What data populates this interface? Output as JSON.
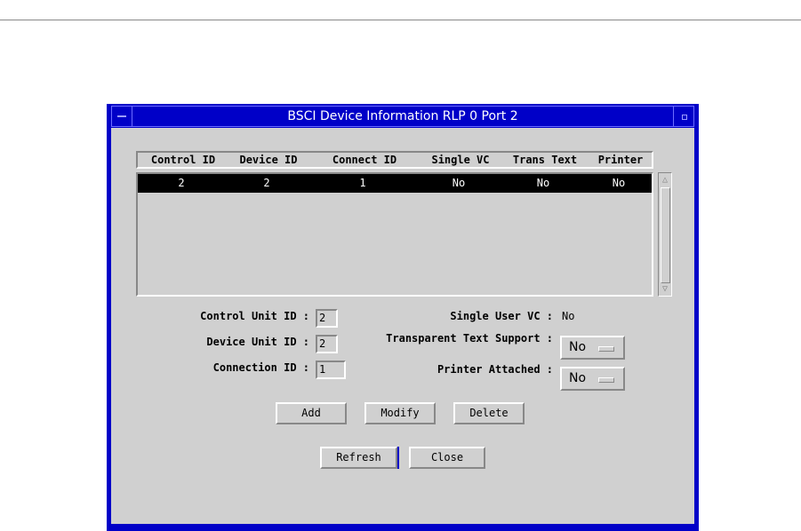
{
  "window": {
    "title": "BSCI Device Information RLP 0 Port 2"
  },
  "table": {
    "columns": [
      "Control ID",
      "Device ID",
      "Connect ID",
      "Single VC",
      "Trans Text",
      "Printer"
    ],
    "rows": [
      [
        "2",
        "2",
        "1",
        "No",
        "No",
        "No"
      ]
    ]
  },
  "form": {
    "control_unit_id": {
      "label": "Control Unit ID :",
      "value": "2"
    },
    "device_unit_id": {
      "label": "Device Unit ID :",
      "value": "2"
    },
    "connection_id": {
      "label": "Connection ID :",
      "value": "1"
    },
    "single_user_vc": {
      "label": "Single User VC :",
      "value": "No"
    },
    "transparent_text": {
      "label": "Transparent Text Support :",
      "value": "No"
    },
    "printer_attached": {
      "label": "Printer Attached :",
      "value": "No"
    }
  },
  "buttons": {
    "add": "Add",
    "modify": "Modify",
    "delete": "Delete",
    "refresh": "Refresh",
    "close": "Close"
  }
}
